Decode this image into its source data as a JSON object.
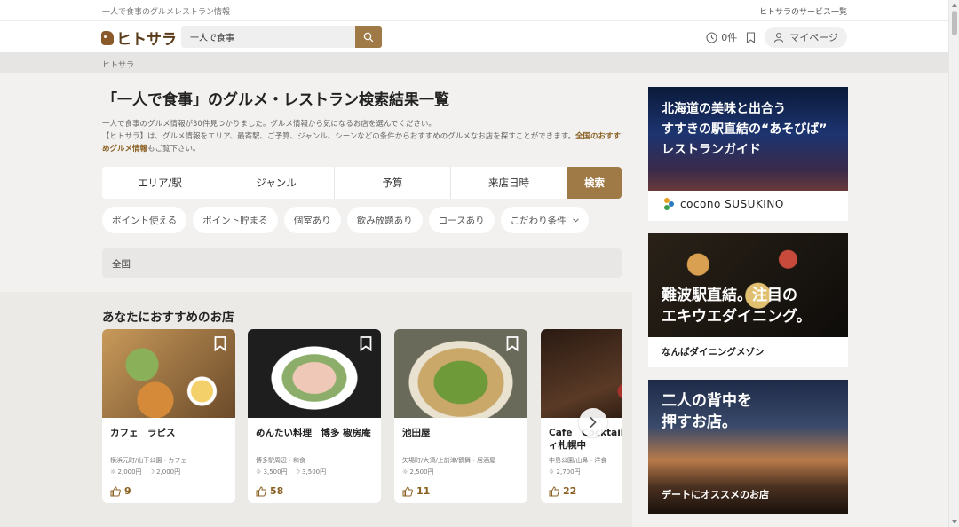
{
  "top": {
    "tagline": "一人で食事のグルメレストラン情報",
    "services": "ヒトサラのサービス一覧"
  },
  "header": {
    "logo": "ヒトサラ",
    "search_value": "一人で食事",
    "history_count": "0件",
    "mypage": "マイページ"
  },
  "breadcrumb": "ヒトサラ",
  "main": {
    "title": "「一人で食事」のグルメ・レストラン検索結果一覧",
    "desc1": "一人で食事のグルメ情報が30件見つかりました。グルメ情報から気になるお店を選んでください。",
    "desc2": "【ヒトサラ】は、グルメ情報をエリア、最寄駅、ご予算、ジャンル、シーンなどの条件からおすすめのグルメなお店を探すことができます。",
    "desc_link": "全国のおすすめグルメ情報",
    "desc3": "もご覧下さい。",
    "tabs": [
      "エリア/駅",
      "ジャンル",
      "予算",
      "来店日時"
    ],
    "search_btn": "検索",
    "chips": [
      "ポイント使える",
      "ポイント貯まる",
      "個室あり",
      "飲み放題あり",
      "コースあり",
      "こだわり条件"
    ],
    "region": "全国",
    "rec_title": "あなたにおすすめのお店"
  },
  "cards": [
    {
      "name": "カフェ　ラピス",
      "area": "横浜元町/山下公園・カフェ",
      "p1": "2,000円",
      "p2": "2,000円",
      "likes": "9",
      "bg": "#b07a3a"
    },
    {
      "name": "めんたい料理　博多 椒房庵",
      "area": "博多駅周辺・和食",
      "p1": "3,500円",
      "p2": "3,500円",
      "likes": "58",
      "bg": "#5e6b55"
    },
    {
      "name": "池田屋",
      "area": "矢場町/大須/上前津/鶴舞・居酒屋",
      "p1": "2,500円",
      "p2": "",
      "likes": "11",
      "bg": "#7d8d4a"
    },
    {
      "name": "Cafe　Cocktail JALシティ札幌中",
      "area": "中島公園/山鼻・洋食",
      "p1": "2,700円",
      "p2": "",
      "likes": "22",
      "bg": "#4a2a1e"
    }
  ],
  "ads": [
    {
      "line1": "北海道の美味と出合う",
      "line2": "すすきの駅直結の“あそびば”",
      "line3": "レストランガイド",
      "caption": "cocono SUSUKINO"
    },
    {
      "line1": "難波駅直結。注目の",
      "line2": "エキウエダイニング。",
      "caption": "なんばダイニングメゾン"
    },
    {
      "line1": "二人の背中を",
      "line2": "押すお店。",
      "caption": "デートにオススメのお店"
    }
  ]
}
